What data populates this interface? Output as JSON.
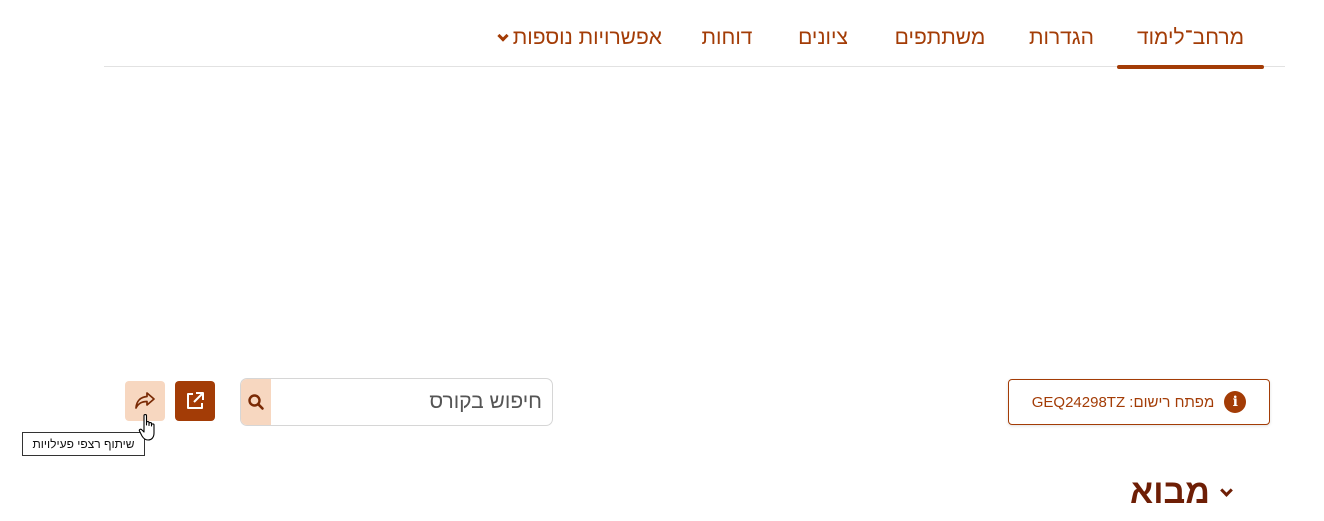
{
  "nav": {
    "tabs": [
      {
        "label": "מרחב־לימוד",
        "active": true
      },
      {
        "label": "הגדרות"
      },
      {
        "label": "משתתפים"
      },
      {
        "label": "ציונים"
      },
      {
        "label": "דוחות"
      },
      {
        "label": "אפשרויות נוספות"
      }
    ]
  },
  "search": {
    "placeholder": "חיפוש בקורס"
  },
  "tooltip": {
    "text": "שיתוף רצפי פעילויות"
  },
  "enrollment": {
    "label": "מפתח רישום: GEQ24298TZ"
  },
  "section": {
    "title": "מבוא"
  },
  "icons": {
    "share": "share-forward-icon",
    "open": "external-link-icon",
    "search": "search-icon",
    "info": "info-icon",
    "collapse": "chevron-down-icon"
  },
  "colors": {
    "accent": "#a33c06",
    "accent_light": "#f7d7c0",
    "heading": "#6e1e05"
  }
}
